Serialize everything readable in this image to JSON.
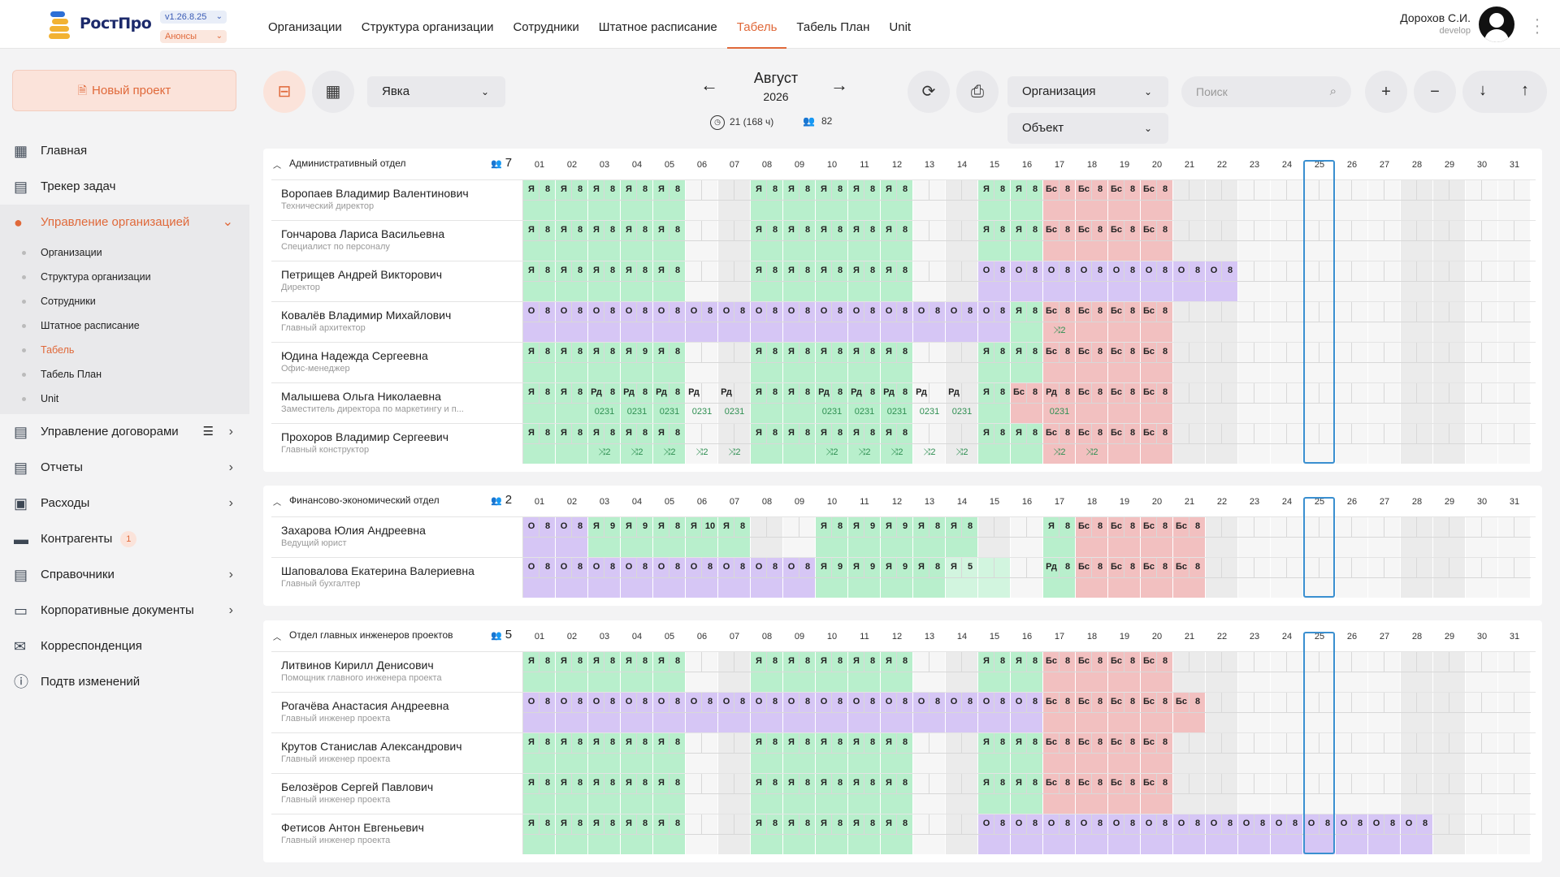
{
  "app": {
    "logo": "РостПро",
    "version": "v1.26.8.25",
    "announcements": "Анонсы"
  },
  "nav": [
    "Организации",
    "Структура организации",
    "Сотрудники",
    "Штатное расписание",
    "Табель",
    "Табель План",
    "Unit"
  ],
  "user": {
    "name": "Дорохов С.И.",
    "role": "develop"
  },
  "sidebar": {
    "new_project": "Новый проект",
    "items": [
      {
        "label": "Главная",
        "icon": "grid-icon"
      },
      {
        "label": "Трекер задач",
        "icon": "document-icon"
      },
      {
        "label": "Управление организацией",
        "icon": "people-icon",
        "open": true
      },
      {
        "label": "Управление договорами",
        "icon": "document-icon"
      },
      {
        "label": "Отчеты",
        "icon": "document-icon"
      },
      {
        "label": "Расходы",
        "icon": "wallet-icon"
      },
      {
        "label": "Контрагенты",
        "icon": "briefcase-icon",
        "badge": "1"
      },
      {
        "label": "Справочники",
        "icon": "document-icon"
      },
      {
        "label": "Корпоративные документы",
        "icon": "folder-icon"
      },
      {
        "label": "Корреспонденция",
        "icon": "mail-icon"
      },
      {
        "label": "Подтв изменений",
        "icon": "info-icon"
      }
    ],
    "subitems": [
      "Организации",
      "Структура организации",
      "Сотрудники",
      "Штатное расписание",
      "Табель",
      "Табель План",
      "Unit"
    ]
  },
  "toolbar": {
    "mode_select": "Явка",
    "month": "Август",
    "year": "2026",
    "hours_stat": "21 (168 ч)",
    "people_stat": "82",
    "org_select": "Организация",
    "object_select": "Объект",
    "search_placeholder": "Поиск"
  },
  "colors": {
    "green": "#b8efcc",
    "green_light": "#d2f5df",
    "purple": "#d6c6f5",
    "red": "#f2c0c0",
    "gray": "#e8e8e8",
    "accent": "#e0693a",
    "selected_day": "#3a8fd0"
  },
  "selected_day": "25",
  "sections": [
    {
      "title": "Административный отдел",
      "count": "7",
      "employees": [
        {
          "name": "Воропаев Владимир Валентинович",
          "position": "Технический директор",
          "days": "GGGGG..GGGGG..GGRRRR.........."
        },
        {
          "name": "Гончарова Лариса Васильевна",
          "position": "Специалист по персоналу",
          "days": "GGGGG..GGGGG..GGRRRR.........."
        },
        {
          "name": "Петрищев Андрей Викторович",
          "position": "Директор",
          "days": "GGGGG..GGGGG..PPPPPPPP........"
        },
        {
          "name": "Ковалёв Владимир Михайлович",
          "position": "Главный архитектор",
          "days": "PPPPPPPPPPPPPPPGRRRR..........",
          "extras": {
            "17": "⤨2"
          }
        },
        {
          "name": "Юдина Надежда Сергеевна",
          "position": "Офис-менеджер",
          "days": "GGGGG..GGGGG..GGRRRR..........",
          "overrides": {
            "04": "Я|9"
          }
        },
        {
          "name": "Малышева Ольга Николаевна",
          "position": "Заместитель директора по маркетингу и п...",
          "days": "GGGGG..GGGGG..GRRRRR..........",
          "rd": [
            "03",
            "04",
            "05",
            "06",
            "07",
            "10",
            "11",
            "12",
            "13",
            "14",
            "17"
          ],
          "extras": {
            "03": "0231",
            "04": "0231",
            "05": "0231",
            "06": "0231",
            "07": "0231",
            "10": "0231",
            "11": "0231",
            "12": "0231",
            "13": "0231",
            "14": "0231",
            "17": "0231"
          }
        },
        {
          "name": "Прохоров Владимир Сергеевич",
          "position": "Главный конструктор",
          "days": "GGGGG..GGGGG..GGRRRR..........",
          "extras": {
            "03": "⤨2",
            "04": "⤨2",
            "05": "⤨2",
            "06": "⤨2",
            "07": "⤨2",
            "10": "⤨2",
            "11": "⤨2",
            "12": "⤨2",
            "13": "⤨2",
            "14": "⤨2",
            "17": "⤨2",
            "18": "⤨2"
          }
        }
      ]
    },
    {
      "title": "Финансово-экономический отдел",
      "count": "2",
      "employees": [
        {
          "name": "Захарова Юлия Андреевна",
          "position": "Ведущий юрист",
          "days": "PPGGGGG..GGGGG..GRRRR..........",
          "overrides": {
            "03": "Я|9",
            "04": "Я|9",
            "05": "Я|8",
            "06": "Я|10",
            "11": "Я|9",
            "12": "Я|9"
          }
        },
        {
          "name": "Шаповалова Екатерина Валериевна",
          "position": "Главный бухгалтер",
          "days": "PPPPPPPPPGGGGLL.GRRRR..........",
          "overrides": {
            "10": "Я|9",
            "11": "Я|9",
            "12": "Я|9",
            "14": "Я|5",
            "15": "|"
          },
          "rd": [
            "17"
          ]
        }
      ]
    },
    {
      "title": "Отдел главных инженеров проектов",
      "count": "5",
      "employees": [
        {
          "name": "Литвинов Кирилл Денисович",
          "position": "Помощник главного инженера проекта",
          "days": "GGGGG..GGGGG..GGRRRR.........."
        },
        {
          "name": "Рогачёва Анастасия Андреевна",
          "position": "Главный инженер проекта",
          "days": "PPPPPPPPPPPPPPPPRRRRR.........."
        },
        {
          "name": "Крутов Станислав Александрович",
          "position": "Главный инженер проекта",
          "days": "GGGGG..GGGGG..GGRRRR.........."
        },
        {
          "name": "Белозёров Сергей Павлович",
          "position": "Главный инженер проекта",
          "days": "GGGGG..GGGGG..GGRRRR.........."
        },
        {
          "name": "Фетисов Антон Евгеньевич",
          "position": "Главный инженер проекта",
          "days": "GGGGG..GGGGG..PPPPPPPPPPPPPP.."
        }
      ]
    }
  ],
  "day_labels": [
    "01",
    "02",
    "03",
    "04",
    "05",
    "06",
    "07",
    "08",
    "09",
    "10",
    "11",
    "12",
    "13",
    "14",
    "15",
    "16",
    "17",
    "18",
    "19",
    "20",
    "21",
    "22",
    "23",
    "24",
    "25",
    "26",
    "27",
    "28",
    "29",
    "30",
    "31"
  ]
}
